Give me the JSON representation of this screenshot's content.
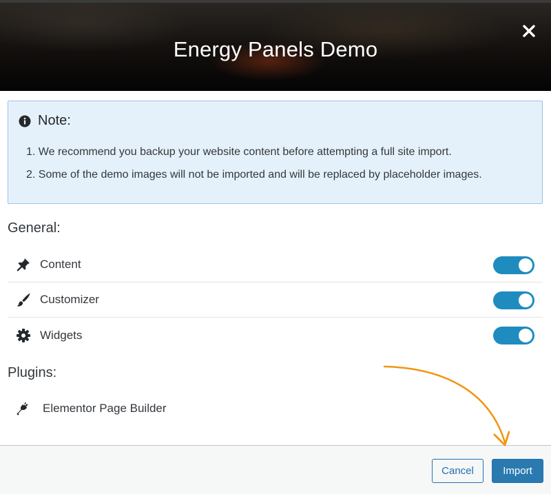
{
  "header": {
    "title": "Energy Panels Demo",
    "close_icon": "close-icon"
  },
  "note": {
    "icon": "info-icon",
    "title": "Note:",
    "items": [
      "1. We recommend you backup your website content before attempting a full site import.",
      "2. Some of the demo images will not be imported and will be replaced by placeholder images."
    ]
  },
  "general": {
    "title": "General:",
    "options": [
      {
        "label": "Content",
        "icon": "pin-icon",
        "enabled": true
      },
      {
        "label": "Customizer",
        "icon": "paintbrush-icon",
        "enabled": true
      },
      {
        "label": "Widgets",
        "icon": "gear-icon",
        "enabled": true
      }
    ]
  },
  "plugins": {
    "title": "Plugins:",
    "items": [
      {
        "label": "Elementor Page Builder",
        "icon": "plug-icon"
      }
    ]
  },
  "footer": {
    "cancel_label": "Cancel",
    "import_label": "Import"
  },
  "colors": {
    "accent": "#2271b1",
    "toggle_on": "#1e8cbe",
    "note_bg": "#e5f1fa",
    "annotation_arrow": "#f0960f"
  }
}
